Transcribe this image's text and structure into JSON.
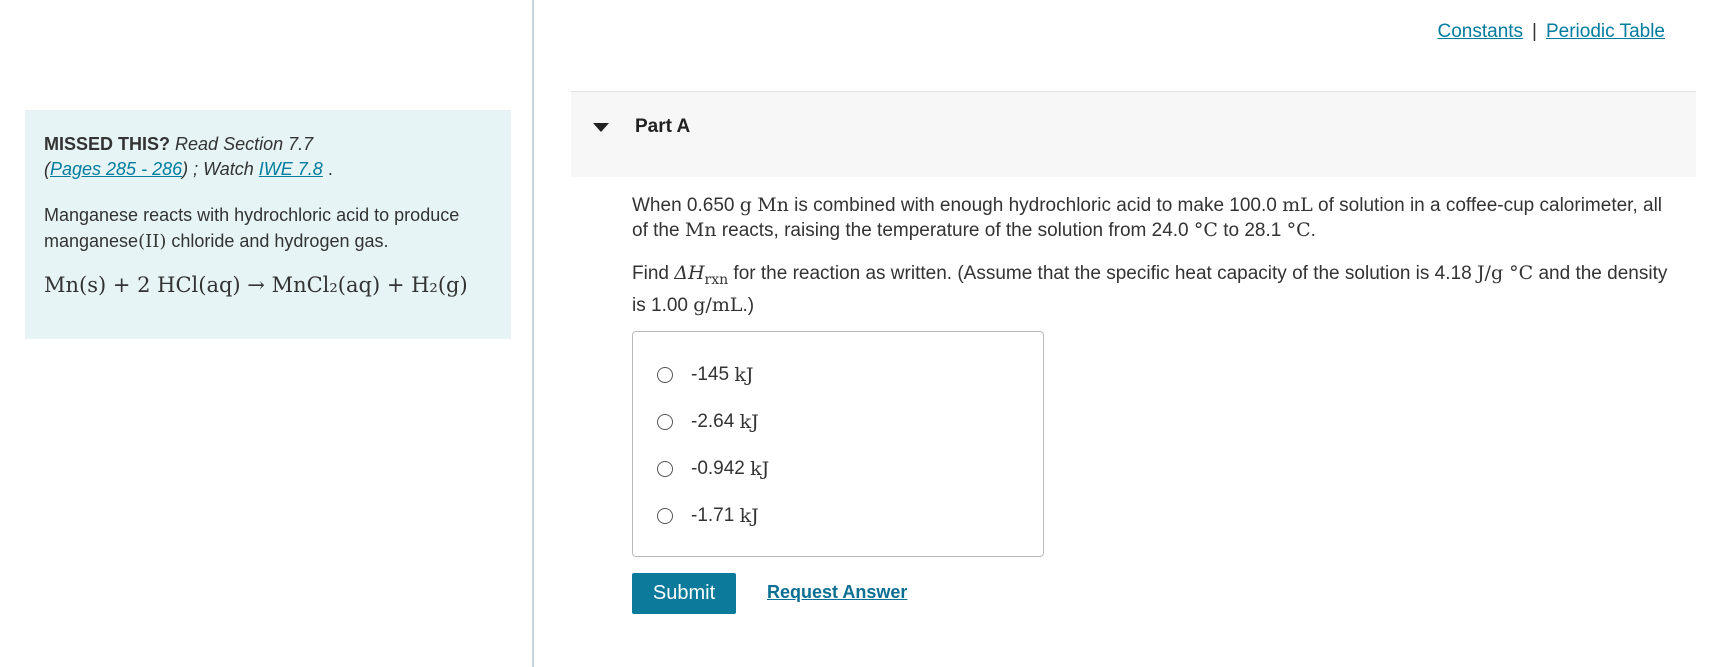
{
  "top_links": {
    "constants": "Constants",
    "separator": "|",
    "periodic_table": "Periodic Table"
  },
  "info": {
    "missed_label": "MISSED THIS?",
    "read_section": "Read Section 7.7",
    "paren_open": "(",
    "pages_link": "Pages 285 - 286",
    "paren_close_watch": ") ; Watch ",
    "iwe_link": "IWE 7.8",
    "period": ".",
    "intro_part1": "Manganese reacts with hydrochloric acid to produce manganese",
    "intro_ox": "(II)",
    "intro_part2": " chloride and hydrogen gas.",
    "equation": "Mn(s) + 2 HCl(aq) → MnCl₂(aq) + H₂(g)"
  },
  "part": {
    "title": "Part A"
  },
  "question": {
    "s1": "When 0.650 ",
    "u_g": "g",
    "sp1": " ",
    "mn1": "Mn",
    "s2": " is combined with enough hydrochloric acid to make 100.0 ",
    "u_ml": "mL",
    "s3": " of solution in a coffee-cup calorimeter, all of the ",
    "mn2": "Mn",
    "s4": " reacts, raising the temperature of the solution from 24.0 ",
    "u_c1": "°C",
    "s5": " to 28.1 ",
    "u_c2": "°C",
    "s6": ".",
    "f1": "Find ",
    "delta_h": "ΔH",
    "rxn": "rxn",
    "f2": " for the reaction as written. (Assume that the specific heat capacity of the solution is 4.18 ",
    "u_jgc": "J/g °C",
    "f3": " and the density is 1.00 ",
    "u_gml": "g/mL",
    "f4": ".)"
  },
  "options": [
    {
      "value": "-145",
      "unit": "kJ"
    },
    {
      "value": "-2.64",
      "unit": "kJ"
    },
    {
      "value": "-0.942",
      "unit": "kJ"
    },
    {
      "value": "-1.71",
      "unit": "kJ"
    }
  ],
  "actions": {
    "submit": "Submit",
    "request_answer": "Request Answer"
  },
  "colors": {
    "panel_bg": "#e6f4f5",
    "link": "#007c9e",
    "submit_bg": "#0b7a9b"
  }
}
